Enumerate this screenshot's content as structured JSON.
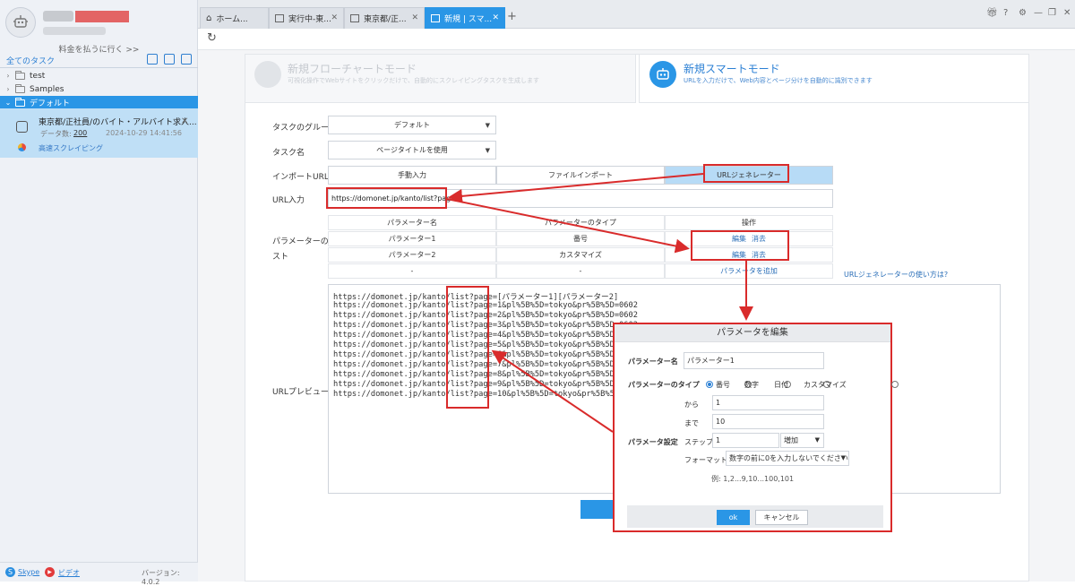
{
  "sidebar": {
    "pay_link": "料金を払うに行く >>",
    "all_tasks": "全てのタスク",
    "tree": [
      {
        "label": "test"
      },
      {
        "label": "Samples"
      },
      {
        "label": "デフォルト"
      }
    ],
    "task": {
      "title": "東京都/正社員/のバイト・アルバイト求人...",
      "count_label": "データ数:",
      "count": "200",
      "date": "2024-10-29 14:41:56",
      "mode": "高速スクレイピング"
    },
    "footer": {
      "skype": "Skype",
      "video": "ビデオ",
      "version": "バージョン: 4.0.2"
    }
  },
  "tabs": [
    {
      "label": "ホーム..."
    },
    {
      "label": "実行中-東..."
    },
    {
      "label": "東京都/正..."
    },
    {
      "label": "新規 | スマ..."
    }
  ],
  "modes": {
    "flow": {
      "title": "新規フローチャートモード",
      "desc": "可視化操作でWebサイトをクリックだけで、自動的にスクレイピングタスクを生成します"
    },
    "smart": {
      "title": "新規スマートモード",
      "desc": "URLを入力だけで、Web内容とページ分けを自動的に識別できます"
    }
  },
  "form": {
    "group_label": "タスクのグループ",
    "group_value": "デフォルト",
    "name_label": "タスク名",
    "name_value": "ページタイトルを使用",
    "import_label": "インポートURL",
    "import_options": [
      "手動入力",
      "ファイルインポート",
      "URLジェネレーター"
    ],
    "url_label": "URL入力",
    "url_value": "https://domonet.jp/kanto/list?page=",
    "param_list_label_1": "パラメーターのリ",
    "param_list_label_2": "スト",
    "table": {
      "headers": [
        "パラメーター名",
        "パラメーターのタイプ",
        "操作"
      ],
      "rows": [
        {
          "name": "パラメーター1",
          "type": "番号",
          "edit": "編集",
          "delete": "消去"
        },
        {
          "name": "パラメーター2",
          "type": "カスタマイズ",
          "edit": "編集",
          "delete": "消去"
        },
        {
          "name": "-",
          "type": "-",
          "add": "パラメータを追加"
        }
      ]
    },
    "help_link": "URLジェネレーターの使い方は?",
    "preview_label": "URLプレビュー",
    "preview_lines": [
      "https://domonet.jp/kanto/list?page=[パラメーター1][パラメーター2]",
      "https://domonet.jp/kanto/list?page=1&pl%5B%5D=tokyo&pr%5B%5D=0602",
      "https://domonet.jp/kanto/list?page=2&pl%5B%5D=tokyo&pr%5B%5D=0602",
      "https://domonet.jp/kanto/list?page=3&pl%5B%5D=tokyo&pr%5B%5D=0602",
      "https://domonet.jp/kanto/list?page=4&pl%5B%5D=tokyo&pr%5B%5D=0602",
      "https://domonet.jp/kanto/list?page=5&pl%5B%5D=tokyo&pr%5B%5D=0602",
      "https://domonet.jp/kanto/list?page=6&pl%5B%5D=tokyo&pr%5B%5D=0602",
      "https://domonet.jp/kanto/list?page=7&pl%5B%5D=tokyo&pr%5B%5D=0602",
      "https://domonet.jp/kanto/list?page=8&pl%5B%5D=tokyo&pr%5B%5D=0602",
      "https://domonet.jp/kanto/list?page=9&pl%5B%5D=tokyo&pr%5B%5D=0602",
      "https://domonet.jp/kanto/list?page=10&pl%5B%5D=tokyo&pr%5B%5D=0602"
    ]
  },
  "dialog": {
    "title": "パラメータを編集",
    "name_label": "パラメーター名",
    "name_value": "パラメーター1",
    "type_label": "パラメーターのタイプ",
    "types": [
      "番号",
      "数字",
      "日付",
      "カスタマイズ"
    ],
    "settings_label": "パラメータ設定",
    "from_label": "から",
    "from_value": "1",
    "to_label": "まで",
    "to_value": "10",
    "step_label": "ステップ",
    "step_value": "1",
    "step_dir": "増加",
    "format_label": "フォーマット",
    "format_value": "数字の前に0を入力しないでください",
    "example": "例: 1,2...9,10...100,101",
    "ok": "ok",
    "cancel": "キャンセル"
  },
  "colors": {
    "accent": "#2a96e6",
    "annotation": "#d92b2b"
  }
}
